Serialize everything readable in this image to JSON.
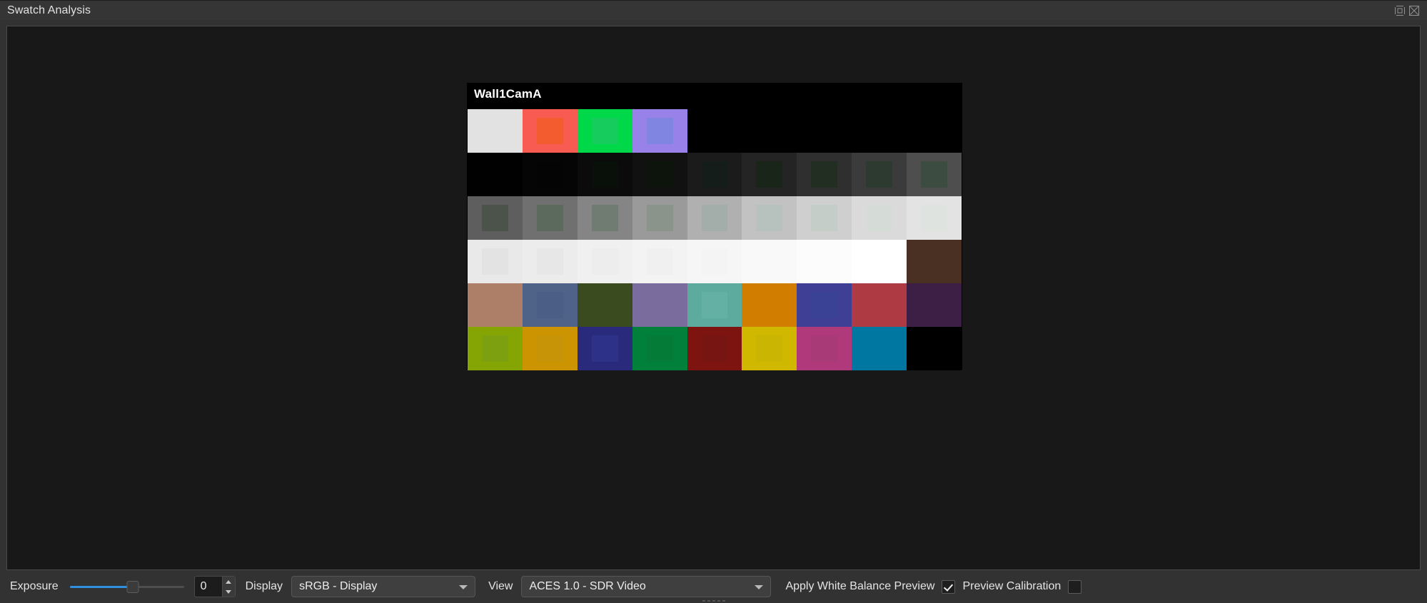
{
  "window": {
    "title": "Swatch Analysis",
    "buttons": [
      {
        "name": "float-window-button",
        "label": "Float"
      },
      {
        "name": "close-panel-button",
        "label": "Close"
      }
    ]
  },
  "viewer": {
    "background": "#181818",
    "plate": {
      "label": "Wall1CamA",
      "background": "#000000",
      "rows": [
        {
          "name": "primaries-row",
          "cells": [
            {
              "outer": "#e2e2e2",
              "inner": "#e2e2e2"
            },
            {
              "outer": "#f85b52",
              "inner": "#f25c2e"
            },
            {
              "outer": "#00d84a",
              "inner": "#16cc5c"
            },
            {
              "outer": "#9882ea",
              "inner": "#7f85e0"
            },
            {
              "outer": "#000000",
              "inner": "#000000"
            },
            {
              "outer": "#000000",
              "inner": "#000000"
            },
            {
              "outer": "#000000",
              "inner": "#000000"
            },
            {
              "outer": "#000000",
              "inner": "#000000"
            },
            {
              "outer": "#000000",
              "inner": "#000000"
            }
          ]
        },
        {
          "name": "dark-ramp-row",
          "cells": [
            {
              "outer": "#010101",
              "inner": "#010101"
            },
            {
              "outer": "#050505",
              "inner": "#040404"
            },
            {
              "outer": "#0b0b0b",
              "inner": "#091009"
            },
            {
              "outer": "#111111",
              "inner": "#0c140c"
            },
            {
              "outer": "#1b1b1b",
              "inner": "#141d19"
            },
            {
              "outer": "#242424",
              "inner": "#192519"
            },
            {
              "outer": "#2f2f2f",
              "inner": "#222e22"
            },
            {
              "outer": "#3b3b3b",
              "inner": "#2c3a2f"
            },
            {
              "outer": "#4e4e4e",
              "inner": "#3d4c41"
            }
          ]
        },
        {
          "name": "mid-gray-ramp-row",
          "cells": [
            {
              "outer": "#5e5e5e",
              "inner": "#4b534b"
            },
            {
              "outer": "#707070",
              "inner": "#5b6a5d"
            },
            {
              "outer": "#858585",
              "inner": "#707b71"
            },
            {
              "outer": "#9a9a9a",
              "inner": "#8a948b"
            },
            {
              "outer": "#b0b0b0",
              "inner": "#a3aeaa"
            },
            {
              "outer": "#c2c2c2",
              "inner": "#b7c2be"
            },
            {
              "outer": "#cfcfcf",
              "inner": "#c5cdc8"
            },
            {
              "outer": "#dadada",
              "inner": "#d5dcd8"
            },
            {
              "outer": "#e3e3e3",
              "inner": "#dfe3e0"
            }
          ]
        },
        {
          "name": "highlight-ramp-row",
          "cells": [
            {
              "outer": "#e9e9e9",
              "inner": "#e3e3e3"
            },
            {
              "outer": "#ececec",
              "inner": "#e7e7e7"
            },
            {
              "outer": "#f0f0f0",
              "inner": "#ededed"
            },
            {
              "outer": "#f3f3f3",
              "inner": "#f0f0f0"
            },
            {
              "outer": "#f6f6f6",
              "inner": "#f4f4f4"
            },
            {
              "outer": "#f9f9f9",
              "inner": "#f9f9f9"
            },
            {
              "outer": "#fcfcfc",
              "inner": "#fcfcfc"
            },
            {
              "outer": "#ffffff",
              "inner": "#ffffff"
            },
            {
              "outer": "#4a3022",
              "inner": "#4a3022"
            }
          ]
        },
        {
          "name": "muted-colors-row",
          "cells": [
            {
              "outer": "#ae7f68",
              "inner": "#ae7f68"
            },
            {
              "outer": "#4f6288",
              "inner": "#4b5f86"
            },
            {
              "outer": "#3a4c1f",
              "inner": "#3a4c1f"
            },
            {
              "outer": "#7a6d9e",
              "inner": "#7a6d9e"
            },
            {
              "outer": "#5dab9e",
              "inner": "#64b0a4"
            },
            {
              "outer": "#d07d00",
              "inner": "#d07d00"
            },
            {
              "outer": "#3f3f96",
              "inner": "#3a4296"
            },
            {
              "outer": "#ae3a44",
              "inner": "#ae3a44"
            },
            {
              "outer": "#3d1f45",
              "inner": "#3d1f45"
            }
          ]
        },
        {
          "name": "saturated-colors-row",
          "cells": [
            {
              "outer": "#85a505",
              "inner": "#7da010"
            },
            {
              "outer": "#cc9400",
              "inner": "#c79307"
            },
            {
              "outer": "#2a2a7d",
              "inner": "#2d3288"
            },
            {
              "outer": "#00803a",
              "inner": "#047c38"
            },
            {
              "outer": "#7d1410",
              "inner": "#761512"
            },
            {
              "outer": "#d1b800",
              "inner": "#cab502"
            },
            {
              "outer": "#b0397b",
              "inner": "#a93a78"
            },
            {
              "outer": "#0077a0",
              "inner": "#0077a0"
            },
            {
              "outer": "#000000",
              "inner": "#000000"
            }
          ]
        }
      ]
    }
  },
  "toolbar": {
    "exposure_label": "Exposure",
    "exposure_value": "0",
    "exposure_slider": {
      "percent": 55,
      "fill_color": "#2f8fe0"
    },
    "display_label": "Display",
    "display_value": "sRGB - Display",
    "view_label": "View",
    "view_value": "ACES 1.0 - SDR Video",
    "apply_white_balance_label": "Apply White Balance Preview",
    "apply_white_balance_checked": true,
    "preview_calibration_label": "Preview Calibration",
    "preview_calibration_checked": false
  }
}
